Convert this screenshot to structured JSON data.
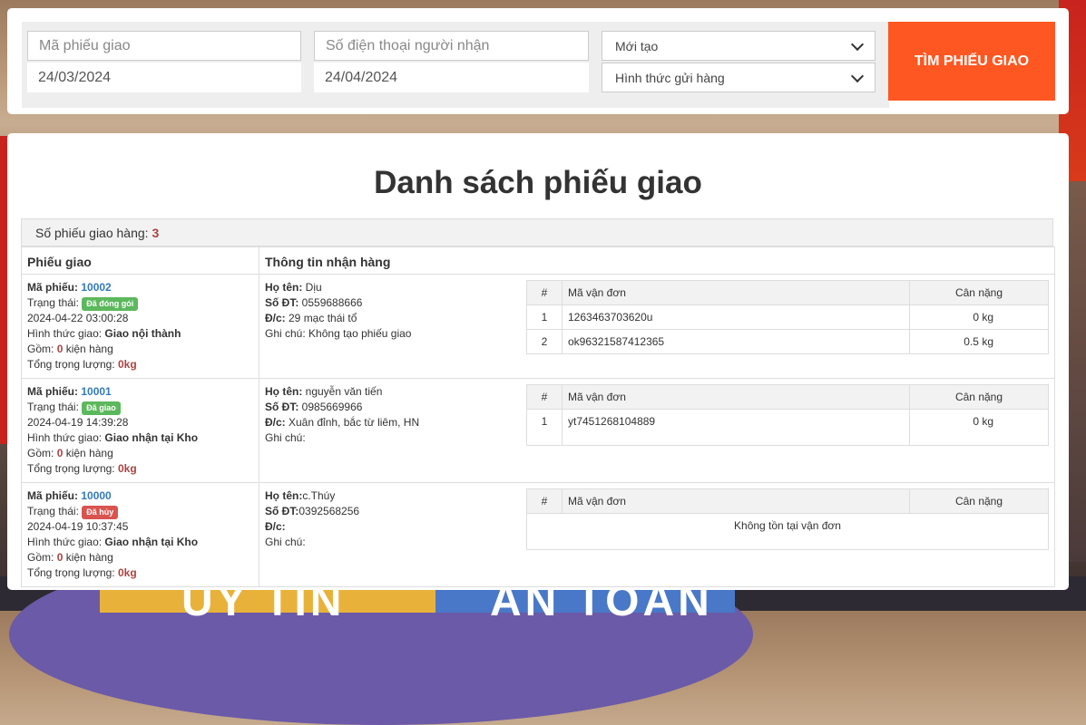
{
  "search": {
    "order_code_placeholder": "Mã phiếu giao",
    "phone_placeholder": "Số điện thoại người nhận",
    "date_from": "24/03/2024",
    "date_to": "24/04/2024",
    "status_selected": "Mới tạo",
    "method_selected": "Hình thức gửi hàng",
    "button_label": "TÌM PHIẾU GIAO"
  },
  "page_title": "Danh sách phiếu giao",
  "summary": {
    "count_label": "Số phiếu giao hàng:",
    "count": "3"
  },
  "table_headers": {
    "order": "Phiếu giao",
    "receiver": "Thông tin nhận hàng"
  },
  "waybill_headers": {
    "index": "#",
    "code": "Mã vận đơn",
    "weight": "Cân nặng"
  },
  "labels": {
    "code": "Mã phiếu:",
    "status": "Trạng thái:",
    "method": "Hình thức giao:",
    "items_prefix": "Gồm:",
    "items_suffix": "kiện hàng",
    "weight": "Tổng trọng lượng:",
    "name": "Họ tên:",
    "phone": "Số ĐT:",
    "address": "Đ/c:",
    "note": "Ghi chú:"
  },
  "orders": [
    {
      "code": "10002",
      "status": "Đã đóng gói",
      "datetime": "2024-04-22 03:00:28",
      "method": "Giao nội thành",
      "items": "0",
      "weight": "0kg",
      "name": " Dịu",
      "phone": " 0559688666",
      "address": " 29 mạc thái tổ",
      "note": " Không tạo phiếu giao",
      "waybills": [
        {
          "index": "1",
          "code": "1263463703620u",
          "weight": "0 kg"
        },
        {
          "index": "2",
          "code": "ok96321587412365",
          "weight": "0.5 kg"
        }
      ]
    },
    {
      "code": "10001",
      "status": "Đã giao",
      "datetime": "2024-04-19 14:39:28",
      "method": "Giao nhận tại Kho",
      "items": "0",
      "weight": "0kg",
      "name": " nguyễn văn tiến",
      "phone": " 0985669966",
      "address": " Xuân đỉnh, bắc từ liêm, HN",
      "note": "",
      "waybills": [
        {
          "index": "1",
          "code": "yt7451268104889",
          "weight": "0 kg"
        }
      ]
    },
    {
      "code": "10000",
      "status": "Đã hủy",
      "datetime": "2024-04-19 10:37:45",
      "method": "Giao nhận tại Kho",
      "items": "0",
      "weight": "0kg",
      "name": "c.Thúy",
      "phone": "0392568256",
      "address": "",
      "note": "",
      "empty_message": "Không tồn tại vận đơn"
    }
  ],
  "background_text": {
    "left": "UY TÍN",
    "right": "AN TOÀN"
  },
  "colors": {
    "accent": "#ff5722",
    "link": "#337ab7",
    "badge_success": "#5cb85c",
    "badge_danger": "#d9534f",
    "emphasis": "#a94442"
  }
}
